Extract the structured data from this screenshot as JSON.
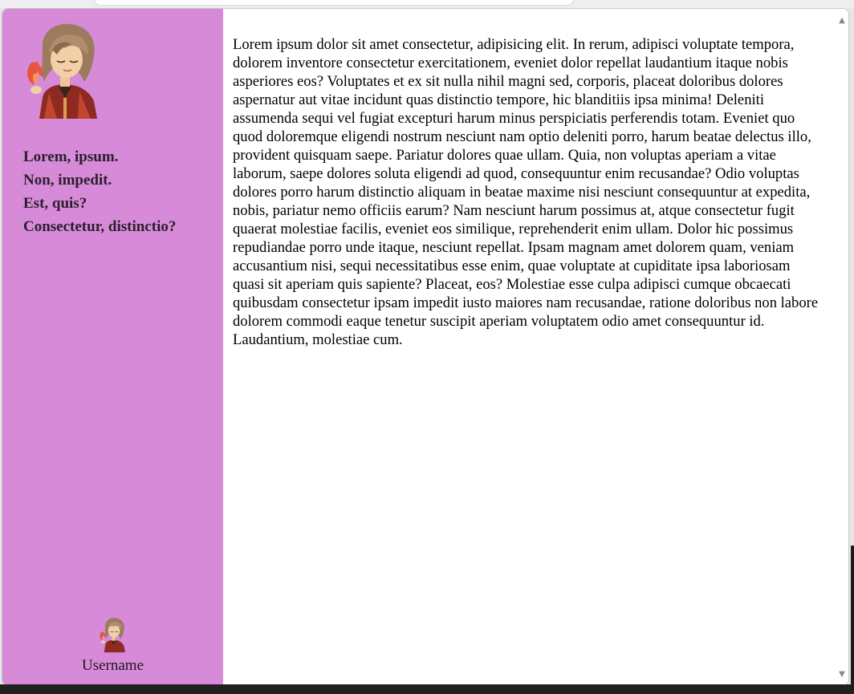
{
  "sidebar": {
    "nav_items": [
      {
        "label": "Lorem, ipsum."
      },
      {
        "label": "Non, impedit."
      },
      {
        "label": "Est, quis?"
      },
      {
        "label": "Consectetur, distinctio?"
      }
    ],
    "username": "Username"
  },
  "main": {
    "body_text": "Lorem ipsum dolor sit amet consectetur, adipisicing elit. In rerum, adipisci voluptate tempora, dolorem inventore consectetur exercitationem, eveniet dolor repellat laudantium itaque nobis asperiores eos? Voluptates et ex sit nulla nihil magni sed, corporis, placeat doloribus dolores aspernatur aut vitae incidunt quas distinctio tempore, hic blanditiis ipsa minima! Deleniti assumenda sequi vel fugiat excepturi harum minus perspiciatis perferendis totam. Eveniet quo quod doloremque eligendi nostrum nesciunt nam optio deleniti porro, harum beatae delectus illo, provident quisquam saepe. Pariatur dolores quae ullam. Quia, non voluptas aperiam a vitae laborum, saepe dolores soluta eligendi ad quod, consequuntur enim recusandae? Odio voluptas dolores porro harum distinctio aliquam in beatae maxime nisi nesciunt consequuntur at expedita, nobis, pariatur nemo officiis earum? Nam nesciunt harum possimus at, atque consectetur fugit quaerat molestiae facilis, eveniet eos similique, reprehenderit enim ullam. Dolor hic possimus repudiandae porro unde itaque, nesciunt repellat. Ipsam magnam amet dolorem quam, veniam accusantium nisi, sequi necessitatibus esse enim, quae voluptate at cupiditate ipsa laboriosam quasi sit aperiam quis sapiente? Placeat, eos? Molestiae esse culpa adipisci cumque obcaecati quibusdam consectetur ipsam impedit iusto maiores nam recusandae, ratione doloribus non labore dolorem commodi eaque tenetur suscipit aperiam voluptatem odio amet consequuntur id. Laudantium, molestiae cum."
  },
  "icons": {
    "profile_image": "avatar-illustration",
    "scroll_up": "triangle-up-icon",
    "scroll_down": "triangle-down-icon"
  },
  "colors": {
    "sidebar_background": "#d68ad8",
    "content_background": "#ffffff",
    "nav_text": "#2a1f2a"
  }
}
